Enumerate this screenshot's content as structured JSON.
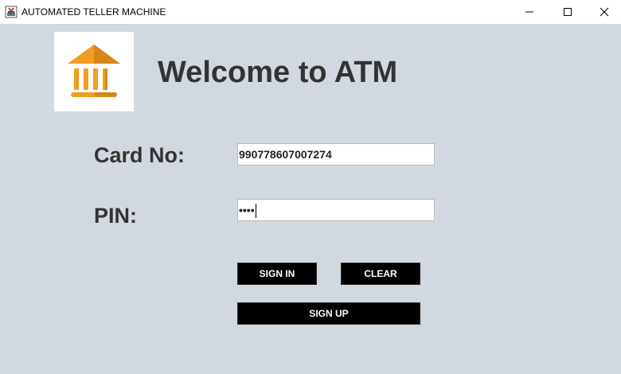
{
  "window": {
    "title": "AUTOMATED TELLER MACHINE",
    "controls": {
      "minimize_icon": "minimize-icon",
      "maximize_icon": "maximize-icon",
      "close_icon": "close-icon"
    }
  },
  "header": {
    "logo_icon": "bank-icon",
    "logo_colors": {
      "primary": "#f39c1f",
      "shadow": "#d7861a"
    },
    "title": "Welcome to ATM"
  },
  "form": {
    "card_label": "Card No:",
    "card_value": "990778607007274",
    "pin_label": "PIN:",
    "pin_masked": "••••"
  },
  "buttons": {
    "sign_in": "SIGN IN",
    "clear": "CLEAR",
    "sign_up": "SIGN UP"
  }
}
